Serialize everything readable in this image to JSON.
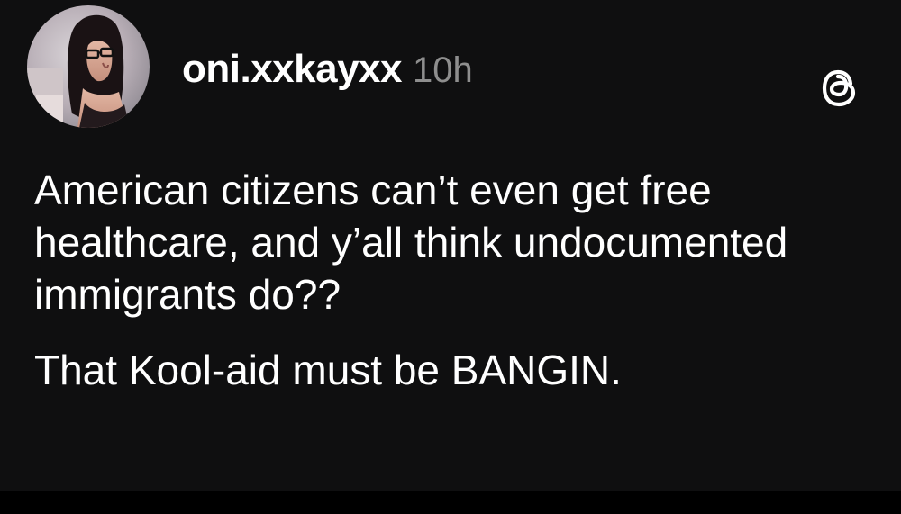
{
  "post": {
    "username": "oni.xxkayxx",
    "timestamp": "10h",
    "avatar_icon": "profile-photo",
    "app_icon": "threads-icon",
    "paragraphs": [
      "American citizens can’t even get free healthcare, and y’all think undocumented immigrants do??",
      "That Kool-aid must be BANGIN."
    ]
  },
  "colors": {
    "background": "#0f0f10",
    "text": "#ffffff",
    "muted": "#8e8e8e"
  }
}
